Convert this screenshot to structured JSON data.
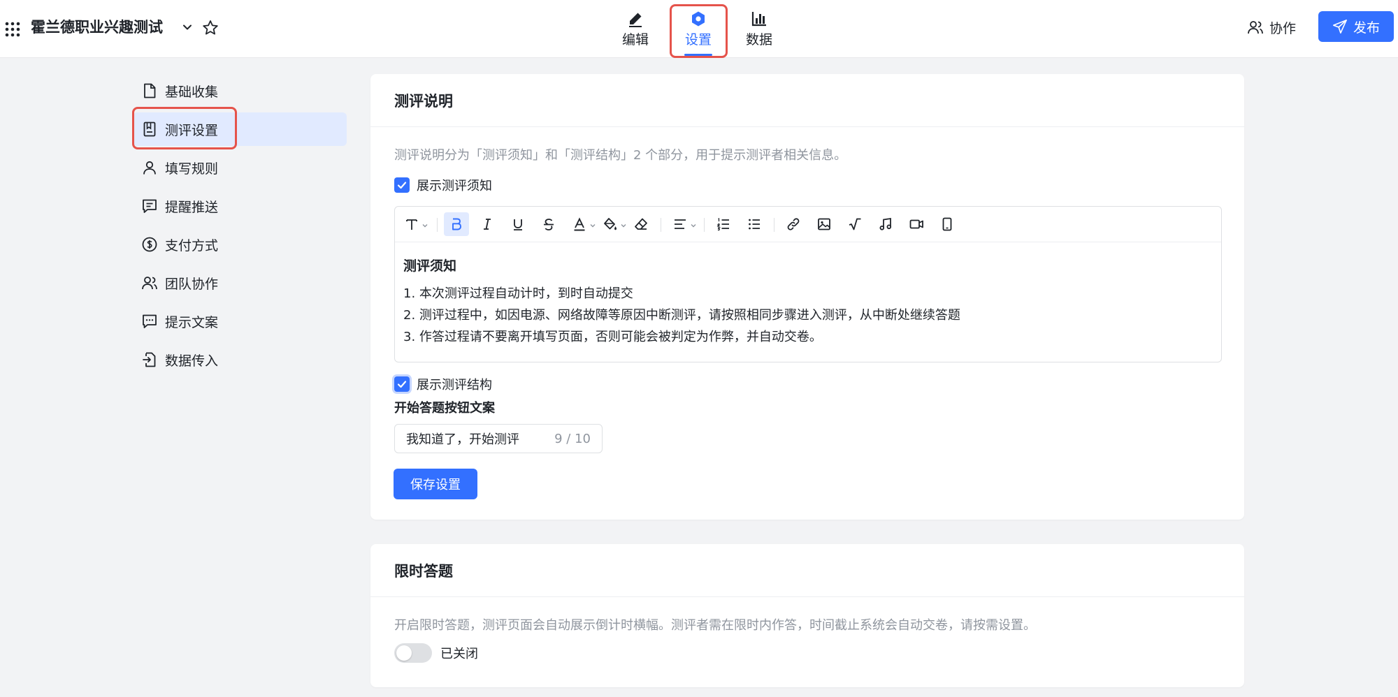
{
  "header": {
    "title": "霍兰德职业兴趣测试",
    "tabs": [
      {
        "label": "编辑",
        "icon": "pen-icon"
      },
      {
        "label": "设置",
        "icon": "settings-icon"
      },
      {
        "label": "数据",
        "icon": "bar-chart-icon"
      }
    ],
    "active_tab": "设置",
    "collaborate_label": "协作",
    "publish_label": "发布"
  },
  "sidebar": {
    "items": [
      {
        "label": "基础收集",
        "icon": "file-icon"
      },
      {
        "label": "测评设置",
        "icon": "bookmark-doc-icon"
      },
      {
        "label": "填写规则",
        "icon": "user-icon"
      },
      {
        "label": "提醒推送",
        "icon": "message-icon"
      },
      {
        "label": "支付方式",
        "icon": "dollar-icon"
      },
      {
        "label": "团队协作",
        "icon": "team-icon"
      },
      {
        "label": "提示文案",
        "icon": "comment-dots-icon"
      },
      {
        "label": "数据传入",
        "icon": "import-icon"
      }
    ],
    "active_item": "测评设置"
  },
  "assessment_intro": {
    "title": "测评说明",
    "description": "测评说明分为「测评须知」和「测评结构」2 个部分，用于提示测评者相关信息。",
    "show_notice_label": "展示测评须知",
    "show_notice_checked": true,
    "editor": {
      "heading": "测评须知",
      "lines": [
        "1. 本次测评过程自动计时，到时自动提交",
        "2. 测评过程中，如因电源、网络故障等原因中断测评，请按照相同步骤进入测评，从中断处继续答题",
        "3. 作答过程请不要离开填写页面，否则可能会被判定为作弊，并自动交卷。"
      ]
    },
    "show_structure_label": "展示测评结构",
    "show_structure_checked": true,
    "start_button_label": "开始答题按钮文案",
    "start_button_value": "我知道了，开始测评",
    "start_button_counter": "9 / 10",
    "save_label": "保存设置"
  },
  "time_limit": {
    "title": "限时答题",
    "description": "开启限时答题，测评页面会自动展示倒计时横幅。测评者需在限时内作答，时间截止系统会自动交卷，请按需设置。",
    "toggle_label": "已关闭",
    "toggle_on": false
  },
  "colors": {
    "accent": "#3370ff",
    "highlight": "#e5534b",
    "active_bg": "#e1eaff"
  }
}
